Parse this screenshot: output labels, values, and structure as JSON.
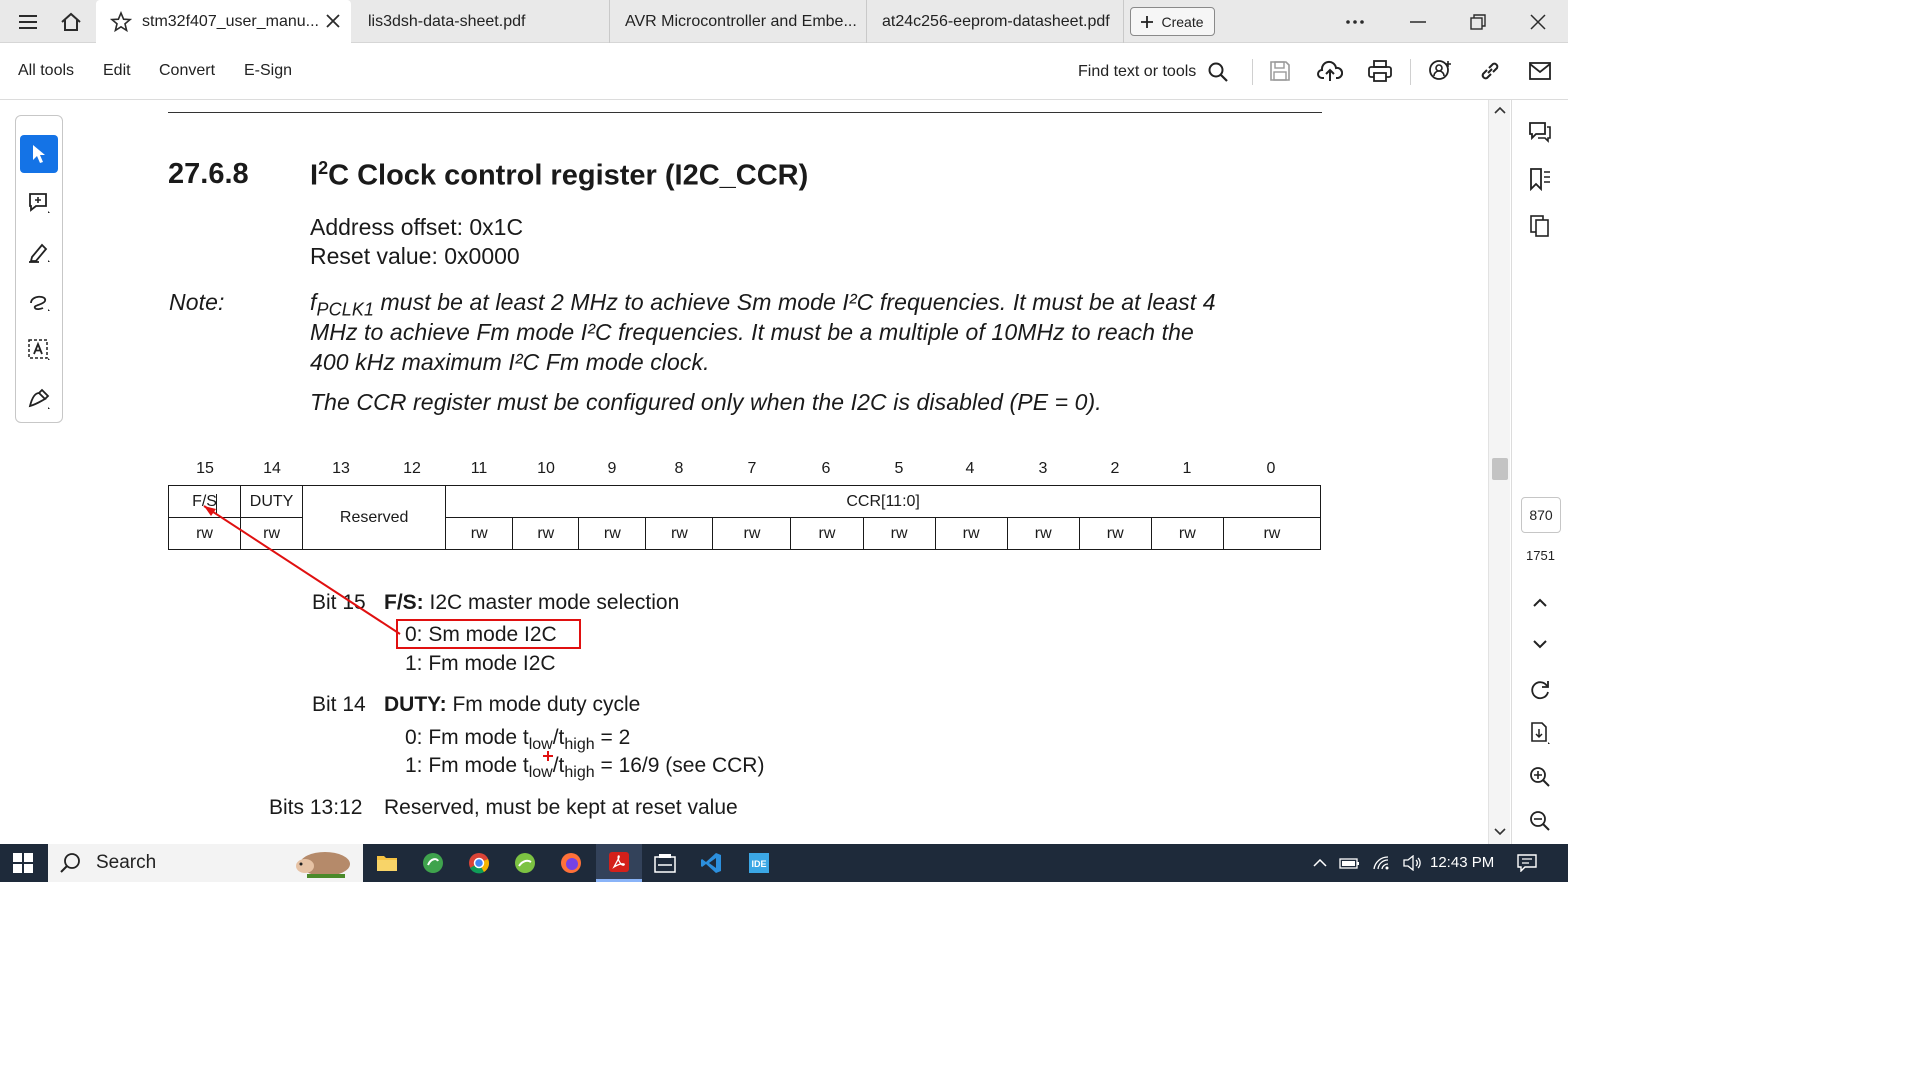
{
  "tabs": [
    {
      "label": "stm32f407_user_manu...",
      "active": true
    },
    {
      "label": "lis3dsh-data-sheet.pdf",
      "active": false
    },
    {
      "label": "AVR Microcontroller and Embe...",
      "active": false
    },
    {
      "label": "at24c256-eeprom-datasheet.pdf",
      "active": false
    }
  ],
  "create_label": "Create",
  "menu": [
    "All tools",
    "Edit",
    "Convert",
    "E-Sign"
  ],
  "find_label": "Find text or tools",
  "page": {
    "current": "870",
    "total": "1751"
  },
  "doc": {
    "section_number": "27.6.8",
    "title_prefix": "I",
    "title_sup": "2",
    "title_rest": "C Clock control register (I2C_CCR)",
    "address_offset": "Address offset: 0x1C",
    "reset_value": "Reset value: 0x0000",
    "note_label": "Note:",
    "note_f": "f",
    "note_sub": "PCLK1",
    "note_line1": " must be at least 2 MHz to achieve Sm mode I²C frequencies. It must be at least 4",
    "note_line2": "MHz to achieve Fm mode I²C frequencies. It must be a multiple of 10MHz to reach the",
    "note_line3": "400 kHz maximum I²C Fm mode clock.",
    "note_line4": "The CCR register must be configured only when the I2C is disabled (PE = 0).",
    "bit_numbers": [
      "15",
      "14",
      "13",
      "12",
      "11",
      "10",
      "9",
      "8",
      "7",
      "6",
      "5",
      "4",
      "3",
      "2",
      "1",
      "0"
    ],
    "fields": {
      "fs": "F/S",
      "duty": "DUTY",
      "reserved": "Reserved",
      "ccr": "CCR[11:0]"
    },
    "access": [
      "rw",
      "rw",
      "rw",
      "rw",
      "rw",
      "rw",
      "rw",
      "rw",
      "rw",
      "rw",
      "rw",
      "rw",
      "rw",
      "rw"
    ],
    "bit15_label": "Bit 15",
    "bit15_name": "F/S:",
    "bit15_desc": " I2C master mode selection",
    "bit15_opt0": "0: Sm mode I2C",
    "bit15_opt1": "1: Fm mode I2C",
    "bit14_label": "Bit 14",
    "bit14_name": "DUTY:",
    "bit14_desc": " Fm mode duty cycle",
    "bit14_opt0_pre": "0: Fm mode t",
    "bit14_opt0_post": " = 2",
    "bit14_opt1_pre": "1: Fm mode t",
    "bit14_opt1_post": " = 16/9 (see CCR)",
    "sub_low": "low",
    "sub_high": "high",
    "slash": "/t",
    "bits1312_label": "Bits 13:12",
    "bits1312_desc": "Reserved, must be kept at reset value"
  },
  "taskbar": {
    "search_label": "Search",
    "time": "12:43 PM"
  },
  "colors": {
    "accent": "#1473e6",
    "annotation": "#e01010",
    "taskbar": "#1e2a3a"
  }
}
